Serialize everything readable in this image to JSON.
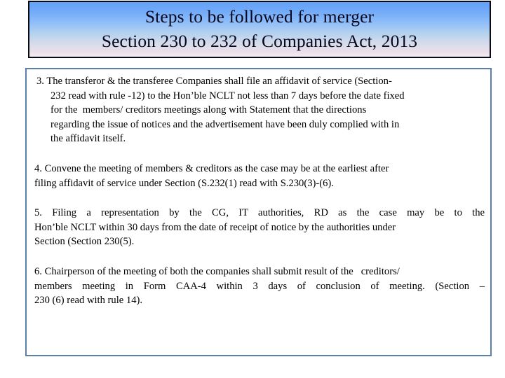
{
  "slide": {
    "background_color": "#ffffff"
  },
  "title": {
    "line1": "Steps to be followed for merger",
    "line2": "Section 230 to 232 of Companies Act, 2013",
    "gradient_top_color": "#63a2f8",
    "gradient_bottom_color": "#f4eaf2",
    "border_color": "#0a0a14",
    "text_color": "#07071e"
  },
  "content": {
    "border_color": "#5b7fa6",
    "background_color": "#ffffff",
    "text_color": "#000000",
    "paragraphs": [
      {
        "number": "3.",
        "lines": [
          "3. The transferor & the transferee Companies shall file an affidavit of service (Section-",
          "232 read with rule -12) to the Hon’ble NCLT not less than 7 days before the date fixed",
          "for the  members/ creditors meetings along with Statement that the directions",
          "regarding the issue of notices and the advertisement have been duly complied with in",
          "the affidavit itself."
        ],
        "full_text": "3. The transferor & the transferee Companies shall file an affidavit of service (Section-232 read with rule -12) to the Hon’ble NCLT not less than 7 days before the date fixed for the  members/ creditors meetings along with Statement that the directions regarding the issue of notices and the advertisement have been duly complied with in the affidavit itself."
      },
      {
        "number": "4.",
        "lines": [
          "4. Convene the meeting of members & creditors as the case may be at the earliest after",
          "filing affidavit of service under Section (S.232(1) read with S.230(3)-(6)."
        ],
        "full_text": "4. Convene the meeting of members & creditors as the case may be at the earliest after filing affidavit of service under Section (S.232(1) read with S.230(3)-(6)."
      },
      {
        "number": "5.",
        "lines": [
          "5. Filing a representation by the CG, IT authorities, RD as the case may be to the",
          "Hon’ble NCLT within 30 days from the date of receipt of notice by the authorities under",
          "Section (Section 230(5)."
        ],
        "full_text": "5. Filing a representation by the CG, IT authorities, RD as the case may be to the Hon’ble NCLT within 30 days from the date of receipt of notice by the authorities under Section (Section 230(5)."
      },
      {
        "number": "6.",
        "lines": [
          "6. Chairperson of the meeting of both the companies shall submit result of the   creditors/",
          "members meeting in Form  CAA-4 within 3 days of conclusion of meeting. (Section –",
          "230 (6) read with rule 14)."
        ],
        "full_text": "6. Chairperson of the meeting of both the companies shall submit result of the   creditors/ members meeting in Form CAA-4 within 3 days of conclusion of meeting. (Section – 230 (6) read with rule 14)."
      }
    ]
  }
}
